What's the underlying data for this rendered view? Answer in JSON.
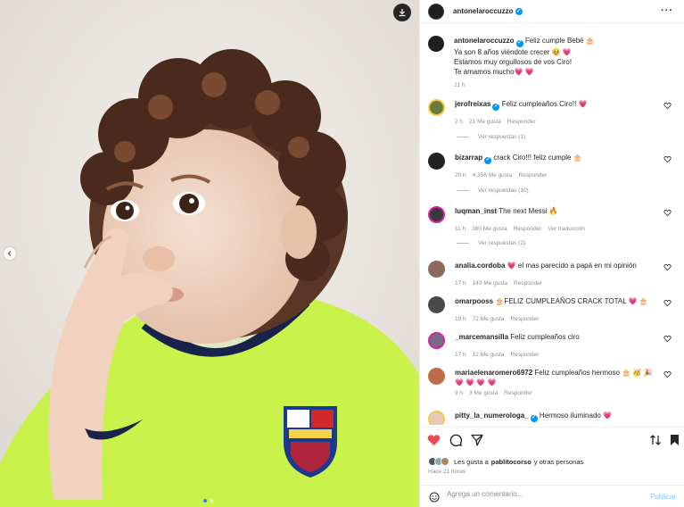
{
  "post": {
    "author": "antonelaroccuzzo",
    "caption_lines": [
      "Feliz cumple Bebé 🎂",
      "Ya son 8 años viéndote crecer 🥹 💗",
      "Estamos muy orgullosos de vos Ciro!",
      "Te amamos mucho💗 💗"
    ],
    "time": "21 h"
  },
  "comments": [
    {
      "user": "jerofreixas",
      "verified": true,
      "text": "Feliz cumpleaños Ciro!! 💗",
      "time": "2 h",
      "likes": "21 Me gusta",
      "reply": "Responder",
      "translate": "",
      "replies": "Ver respuestas (1)"
    },
    {
      "user": "bizarrap",
      "verified": true,
      "text": "crack Ciro!!! feliz cumple 🎂",
      "time": "20 h",
      "likes": "4,356 Me gusta",
      "reply": "Responder",
      "translate": "",
      "replies": "Ver respuestas (10)"
    },
    {
      "user": "luqman_inst",
      "verified": false,
      "text": "The next Messi 🔥",
      "time": "11 h",
      "likes": "360 Me gusta",
      "reply": "Responder",
      "translate": "Ver traducción",
      "replies": "Ver respuestas (2)"
    },
    {
      "user": "analia.cordoba",
      "verified": false,
      "text": "💗 el mas parecido a papá en mi opinión",
      "time": "17 h",
      "likes": "143 Me gusta",
      "reply": "Responder",
      "translate": "",
      "replies": ""
    },
    {
      "user": "omarpooss",
      "verified": false,
      "text": "🎂FELIZ CUMPLEAÑOS CRACK TOTAL 💗 🎂",
      "time": "19 h",
      "likes": "72 Me gusta",
      "reply": "Responder",
      "translate": "",
      "replies": ""
    },
    {
      "user": "_marcemansilla",
      "verified": false,
      "text": "Feliz cumpleaños ciro",
      "time": "17 h",
      "likes": "12 Me gusta",
      "reply": "Responder",
      "translate": "",
      "replies": ""
    },
    {
      "user": "mariaelenaromero6972",
      "verified": false,
      "text": "Feliz cumpleaños hermoso 🎂 🥳 🎉 💗 💗 💗 💗",
      "time": "9 h",
      "likes": "3 Me gusta",
      "reply": "Responder",
      "translate": "",
      "replies": ""
    },
    {
      "user": "pitty_la_numerologa_",
      "verified": true,
      "text": "Hermoso iluminado 💗",
      "time": "",
      "likes": "",
      "reply": "",
      "translate": "",
      "replies": ""
    }
  ],
  "liked_by": {
    "prefix": "Les gusta a ",
    "user": "pablitocorso",
    "suffix": " y otras personas"
  },
  "posted_ago": "Hace 21 horas",
  "comment_box": {
    "placeholder": "Agrega un comentario...",
    "publish": "Publicar"
  },
  "colors": {
    "like_red": "#ed4956",
    "link_blue": "#0095f6",
    "jersey": "#c9f24a"
  }
}
